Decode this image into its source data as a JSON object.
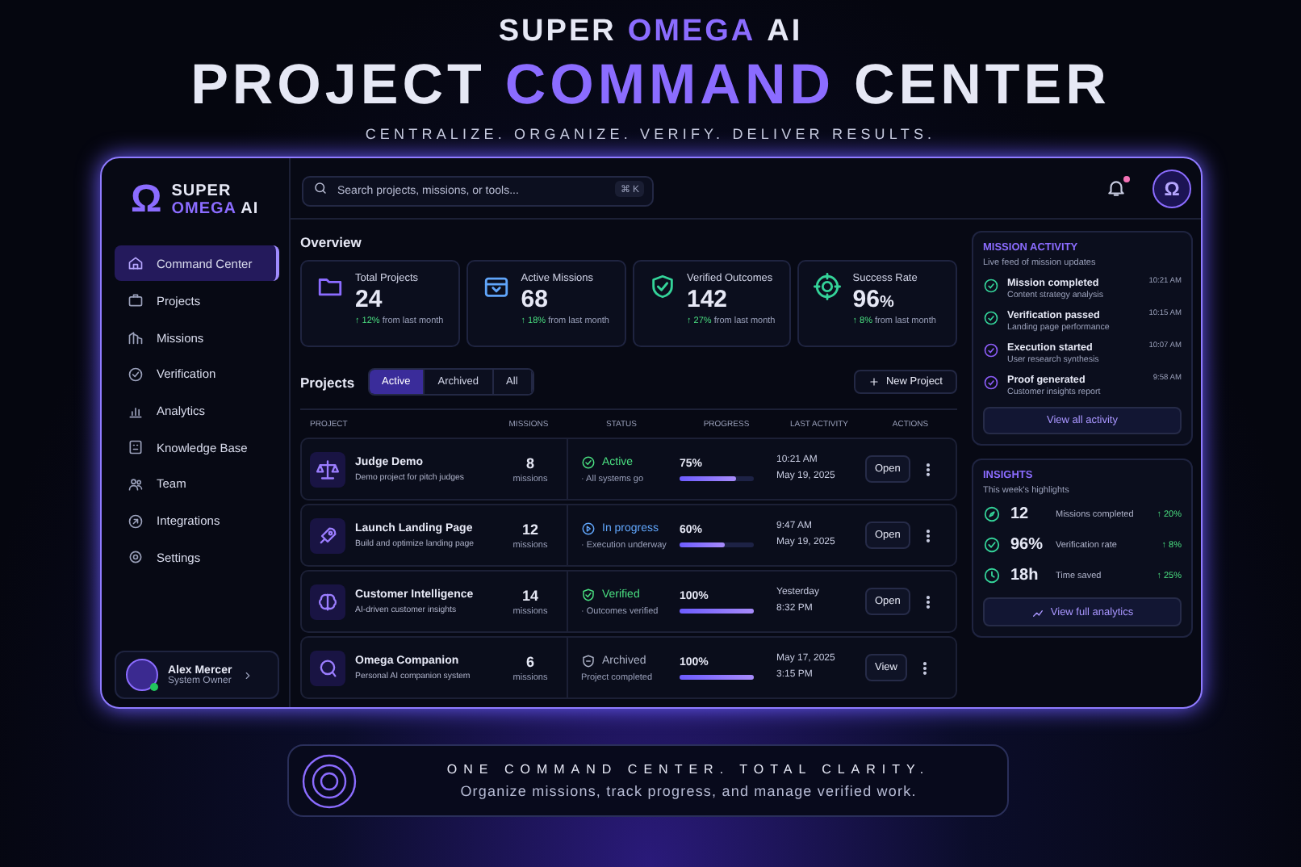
{
  "header": {
    "brand": [
      {
        "text": "SUPER",
        "accent": false
      },
      {
        "text": "OMEGA",
        "accent": true
      },
      {
        "text": "AI",
        "accent": false
      }
    ],
    "title": [
      {
        "text": "PROJECT",
        "accent": false
      },
      {
        "text": "COMMAND",
        "accent": true
      },
      {
        "text": "CENTER",
        "accent": false
      }
    ],
    "tagline": "CENTRALIZE. ORGANIZE. VERIFY. DELIVER RESULTS."
  },
  "sidebar": {
    "logo_mark": "Ω",
    "logo": [
      {
        "text": "SUPER",
        "accent": false
      },
      {
        "text": "OMEGA",
        "accent": true
      },
      {
        "text": "AI",
        "accent": false
      }
    ],
    "items": [
      {
        "label": "Command Center",
        "selected": true
      },
      {
        "label": "Projects",
        "selected": false
      },
      {
        "label": "Missions",
        "selected": false
      },
      {
        "label": "Verification",
        "selected": false
      },
      {
        "label": "Analytics",
        "selected": false
      },
      {
        "label": "Knowledge Base",
        "selected": false
      },
      {
        "label": "Team",
        "selected": false
      },
      {
        "label": "Integrations",
        "selected": false
      },
      {
        "label": "Settings",
        "selected": false
      }
    ],
    "user": {
      "name": "Alex Mercer",
      "role": "System Owner",
      "online": true
    }
  },
  "search": {
    "placeholder": "Search projects, missions, or tools...",
    "shortcut": "⌘ K"
  },
  "notifications": {
    "unread": true
  },
  "account": {
    "mark": "Ω"
  },
  "overview": {
    "title": "Overview",
    "stats": [
      {
        "label": "Total Projects",
        "value": "24",
        "delta": "↑ 12%",
        "note": "from last month"
      },
      {
        "label": "Active Missions",
        "value": "68",
        "delta": "↑ 18%",
        "note": "from last month"
      },
      {
        "label": "Verified Outcomes",
        "value": "142",
        "delta": "↑ 27%",
        "note": "from last month"
      },
      {
        "label": "Success Rate",
        "value": "96",
        "unit": "%",
        "delta": "↑ 8%",
        "note": "from last month"
      }
    ]
  },
  "projects": {
    "title": "Projects",
    "tabs": [
      {
        "label": "Active",
        "selected": true
      },
      {
        "label": "Archived",
        "selected": false
      },
      {
        "label": "All",
        "selected": false
      }
    ],
    "new_button": "New Project",
    "columns": [
      "PROJECT",
      "MISSIONS",
      "STATUS",
      "PROGRESS",
      "LAST ACTIVITY",
      "ACTIONS"
    ],
    "rows": [
      {
        "name": "Judge Demo",
        "description": "Demo project for pitch judges",
        "count": "8",
        "count_label": "missions",
        "status": {
          "kind": "active",
          "label": "Active",
          "note": "· All systems go"
        },
        "progress": "75%",
        "level": 0.75,
        "activity": [
          "10:21 AM",
          "May 19, 2025"
        ],
        "action": "Open"
      },
      {
        "name": "Launch Landing Page",
        "description": "Build and optimize landing page",
        "count": "12",
        "count_label": "missions",
        "status": {
          "kind": "progress",
          "label": "In progress",
          "note": "· Execution underway"
        },
        "progress": "60%",
        "level": 0.6,
        "activity": [
          "9:47 AM",
          "May 19, 2025"
        ],
        "action": "Open"
      },
      {
        "name": "Customer Intelligence",
        "description": "AI-driven customer insights",
        "count": "14",
        "count_label": "missions",
        "status": {
          "kind": "verified",
          "label": "Verified",
          "note": "· Outcomes verified"
        },
        "progress": "100%",
        "level": 1,
        "activity": [
          "Yesterday",
          "8:32 PM"
        ],
        "action": "Open"
      },
      {
        "name": "Omega Companion",
        "description": "Personal AI companion system",
        "count": "6",
        "count_label": "missions",
        "status": {
          "kind": "archived",
          "label": "Archived",
          "note": "Project completed"
        },
        "progress": "100%",
        "level": 1,
        "activity": [
          "May 17, 2025",
          "3:15 PM"
        ],
        "action": "View"
      }
    ]
  },
  "activity": {
    "title": "MISSION ACTIVITY",
    "subtitle": "Live feed of mission updates",
    "items": [
      {
        "title": "Mission completed",
        "detail": "Content strategy analysis",
        "time": "10:21 AM",
        "color": "#34d399"
      },
      {
        "title": "Verification passed",
        "detail": "Landing page performance",
        "time": "10:15 AM",
        "color": "#34d399"
      },
      {
        "title": "Execution started",
        "detail": "User research synthesis",
        "time": "10:07 AM",
        "color": "#8b5cf6"
      },
      {
        "title": "Proof generated",
        "detail": "Customer insights report",
        "time": "9:58 AM",
        "color": "#8b5cf6"
      }
    ],
    "button": "View all activity"
  },
  "insights": {
    "title": "INSIGHTS",
    "subtitle": "This week's highlights",
    "items": [
      {
        "value": "12",
        "label": "Missions completed",
        "delta": "↑ 20%"
      },
      {
        "value": "96%",
        "label": "Verification rate",
        "delta": "↑ 8%"
      },
      {
        "value": "18h",
        "label": "Time saved",
        "delta": "↑ 25%"
      }
    ],
    "button": "View full analytics"
  },
  "banner": {
    "headline": "ONE COMMAND CENTER. TOTAL CLARITY.",
    "text": "Organize missions, track progress, and manage verified work."
  }
}
